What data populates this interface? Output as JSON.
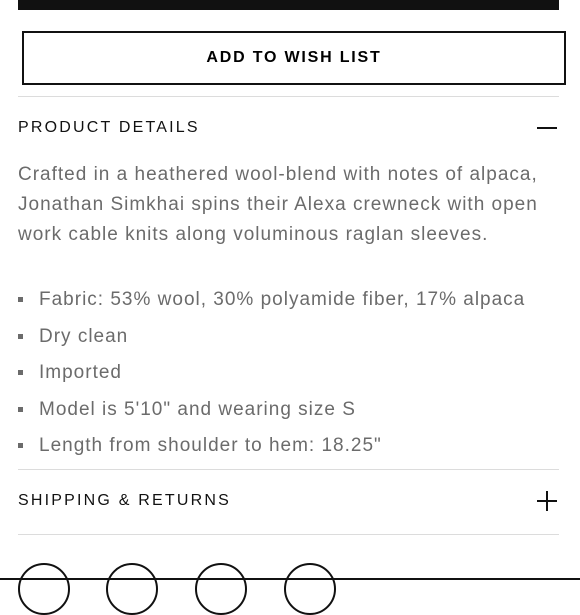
{
  "wishlist": {
    "label": "ADD TO WISH LIST"
  },
  "product_details": {
    "title": "PRODUCT DETAILS",
    "toggle_icon": "minus-icon",
    "description": "Crafted in a heathered wool-blend with notes of alpaca, Jonathan Simkhai spins their Alexa crewneck with open work cable knits along voluminous raglan sleeves.",
    "bullets": [
      "Fabric: 53% wool, 30% polyamide fiber, 17% alpaca",
      "Dry clean",
      "Imported",
      "Model is 5'10\" and wearing size S",
      "Length from shoulder to hem: 18.25\""
    ]
  },
  "shipping": {
    "title": "SHIPPING & RETURNS",
    "toggle_icon": "plus-icon"
  },
  "colors": {
    "text": "#111111",
    "muted": "#6b6b6b",
    "divider": "#dcdcdc"
  }
}
